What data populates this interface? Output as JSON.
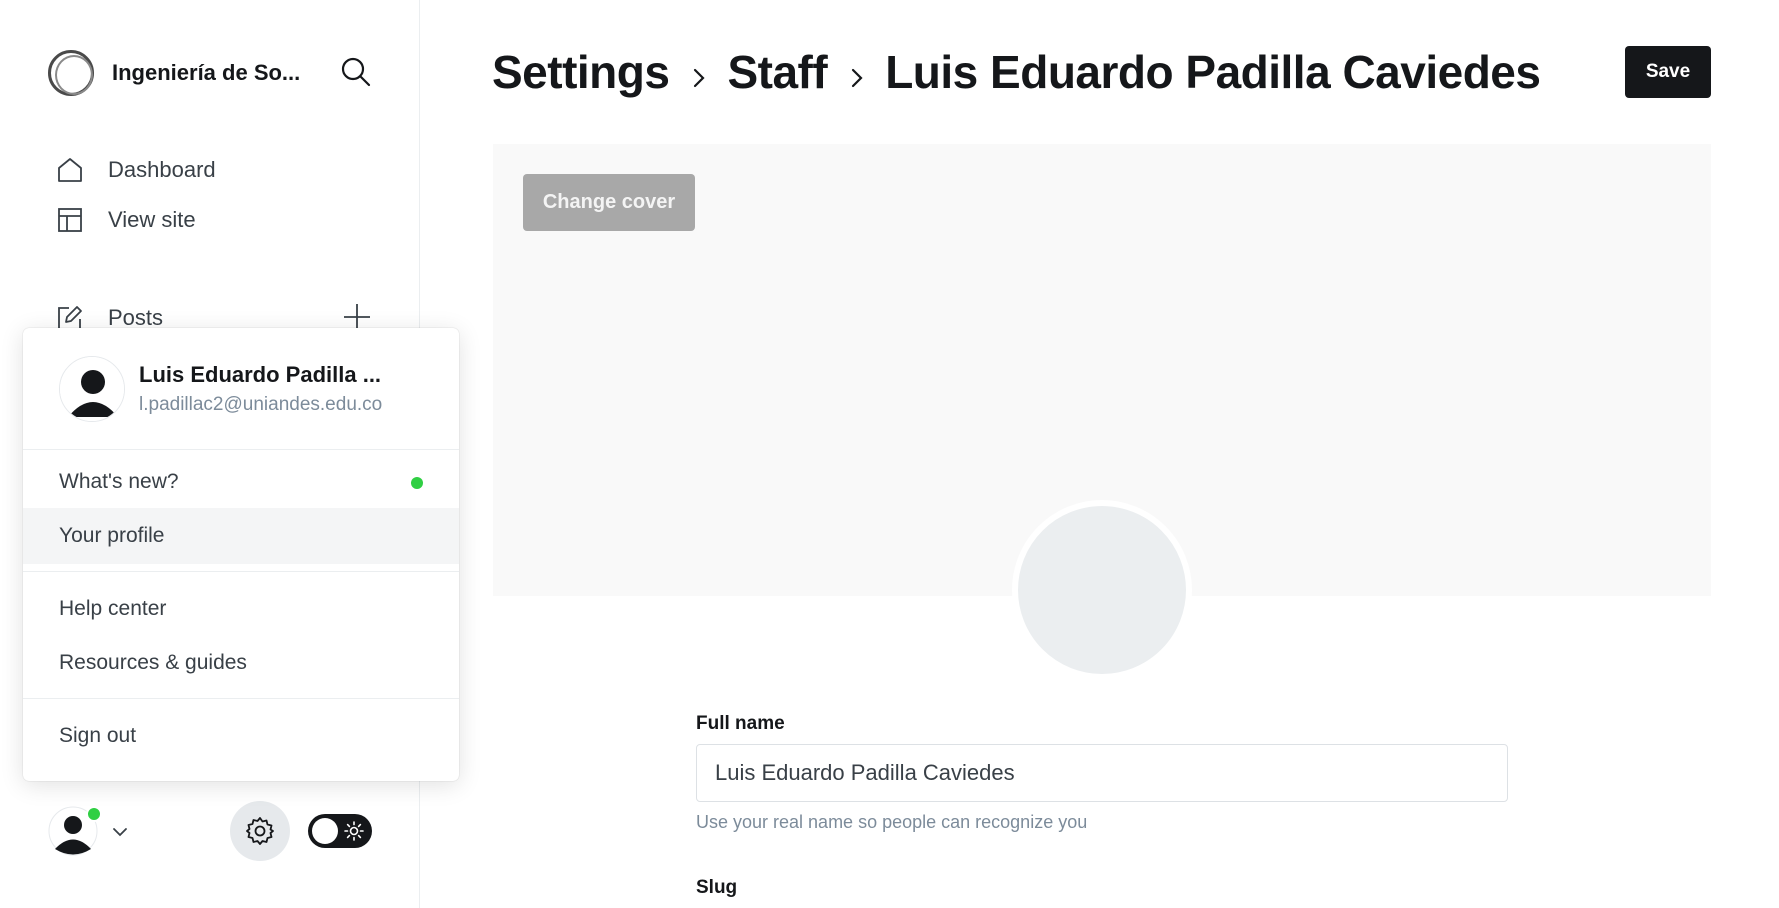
{
  "sidebar": {
    "site_name": "Ingeniería de So...",
    "nav": {
      "dashboard": "Dashboard",
      "view_site": "View site",
      "posts": "Posts"
    }
  },
  "dropdown": {
    "user_name": "Luis Eduardo Padilla ...",
    "user_email": "l.padillac2@uniandes.edu.co",
    "items": {
      "whats_new": "What's new?",
      "your_profile": "Your profile",
      "help_center": "Help center",
      "resources": "Resources & guides",
      "sign_out": "Sign out"
    }
  },
  "header": {
    "crumb_settings": "Settings",
    "crumb_staff": "Staff",
    "crumb_user": "Luis Eduardo Padilla Caviedes",
    "save_label": "Save"
  },
  "profile": {
    "change_cover_label": "Change cover",
    "full_name_label": "Full name",
    "full_name_value": "Luis Eduardo Padilla Caviedes",
    "full_name_hint": "Use your real name so people can recognize you",
    "slug_label": "Slug"
  },
  "colors": {
    "accent_dark": "#15171a",
    "online_green": "#30cf43",
    "muted_text": "#7c8b9a"
  },
  "icons": [
    "site-logo-icon",
    "search-icon",
    "home-icon",
    "layout-icon",
    "pencil-icon",
    "plus-icon",
    "user-avatar-icon",
    "chevron-down-icon",
    "gear-icon",
    "sun-icon",
    "chevron-right-icon"
  ]
}
